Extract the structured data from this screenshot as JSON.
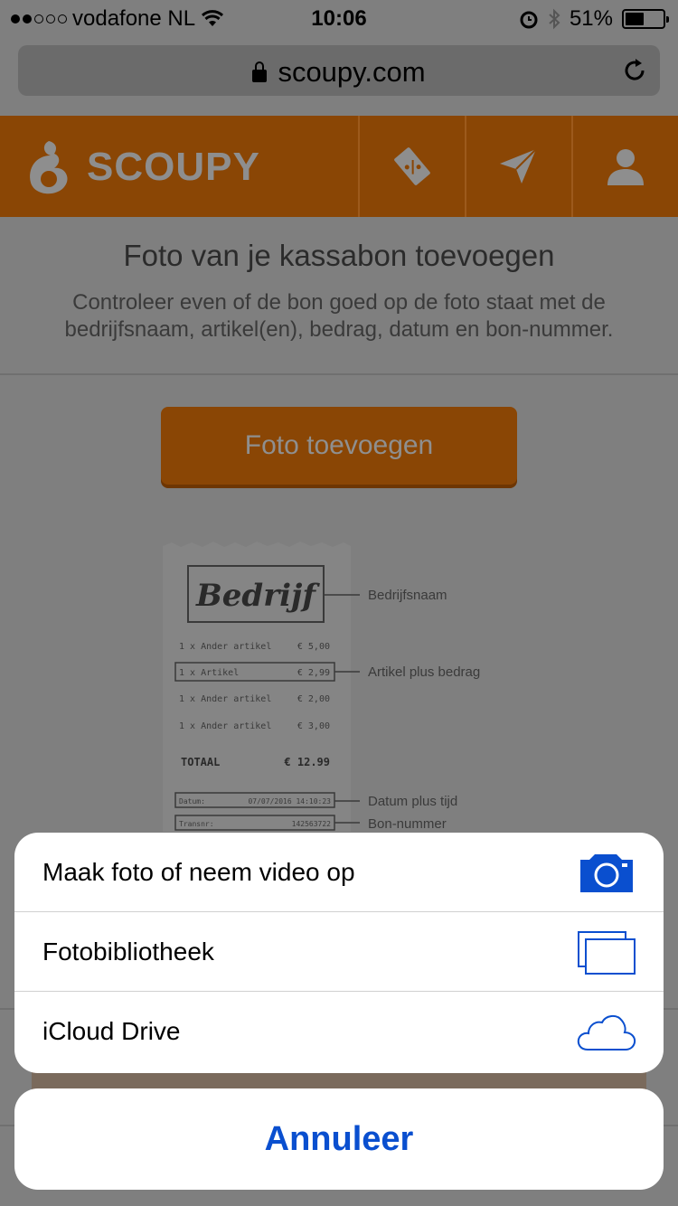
{
  "status_bar": {
    "carrier": "vodafone NL",
    "time": "10:06",
    "battery": "51%",
    "battery_level": 0.51
  },
  "browser": {
    "url": "scoupy.com"
  },
  "header": {
    "logo_text": "SCOUPY"
  },
  "page": {
    "title": "Foto van je kassabon toevoegen",
    "description": "Controleer even of de bon goed op de foto staat met de bedrijfsnaam, artikel(en), bedrag, datum en bon-nummer.",
    "add_photo_button": "Foto toevoegen"
  },
  "receipt": {
    "company": "Bedrijf",
    "lines": [
      {
        "item": "1 x Ander artikel",
        "price": "€ 5,00"
      },
      {
        "item": "1 x Artikel",
        "price": "€ 2,99"
      },
      {
        "item": "1 x Ander artikel",
        "price": "€ 2,00"
      },
      {
        "item": "1 x Ander artikel",
        "price": "€ 3,00"
      }
    ],
    "total_label": "TOTAAL",
    "total_value": "€ 12.99",
    "date_label": "Datum:",
    "date_value": "07/07/2016 14:10:23",
    "trans_label": "Transnr:",
    "trans_value": "142563722",
    "annotations": {
      "company": "Bedrijfsnaam",
      "article": "Artikel plus bedrag",
      "date": "Datum plus tijd",
      "number": "Bon-nummer"
    }
  },
  "action_sheet": {
    "items": [
      {
        "label": "Maak foto of neem video op",
        "icon": "camera-icon"
      },
      {
        "label": "Fotobibliotheek",
        "icon": "photo-library-icon"
      },
      {
        "label": "iCloud Drive",
        "icon": "cloud-icon"
      }
    ],
    "cancel": "Annuleer",
    "accent": "#0a4fcf"
  }
}
